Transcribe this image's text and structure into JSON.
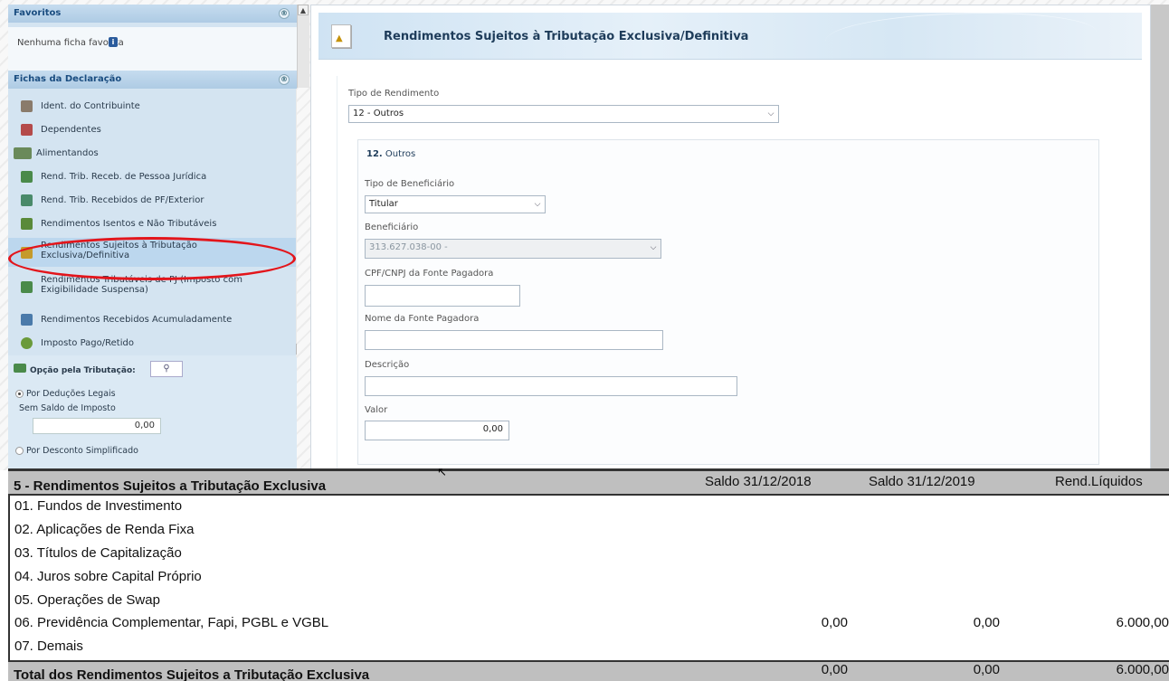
{
  "sidebar": {
    "favoritos": {
      "title": "Favoritos",
      "toggle": "®",
      "empty_text": "Nenhuma ficha favorita",
      "info_icon": "info-icon"
    },
    "fichas": {
      "title": "Fichas da Declaração",
      "toggle": "®",
      "items": [
        {
          "label": "Ident. do Contribuinte",
          "icon": "person-icon",
          "color": "#8a7b6b"
        },
        {
          "label": "Dependentes",
          "icon": "dependents-icon",
          "color": "#b44a4a"
        },
        {
          "label": "Alimentandos",
          "icon": "alimentandos-icon",
          "color": "#6a8a5a"
        },
        {
          "label": "Rend. Trib. Receb. de Pessoa Jurídica",
          "icon": "money-icon",
          "color": "#4a8a4a"
        },
        {
          "label": "Rend. Trib. Recebidos de PF/Exterior",
          "icon": "money-icon",
          "color": "#4a8a6a"
        },
        {
          "label": "Rendimentos Isentos e Não Tributáveis",
          "icon": "document-icon",
          "color": "#5a8a3a"
        },
        {
          "label": "Rendimentos Sujeitos à Tributação Exclusiva/Definitiva",
          "icon": "document-warning-icon",
          "color": "#c59a2a"
        },
        {
          "label": "Rendimentos Tributáveis de PJ (Imposto com Exigibilidade Suspensa)",
          "icon": "money-icon",
          "color": "#4a8a4a"
        },
        {
          "label": "Rendimentos Recebidos Acumuladamente",
          "icon": "document-icon",
          "color": "#4a7aaa"
        },
        {
          "label": "Imposto Pago/Retido",
          "icon": "coin-icon",
          "color": "#6a9a3a"
        }
      ]
    },
    "opcao": {
      "title": "Opção pela Tributação:",
      "option1": "Por Deduções Legais",
      "saldo_label": "Sem Saldo de Imposto",
      "saldo_value": "0,00",
      "option2": "Por Desconto Simplificado"
    }
  },
  "main": {
    "title": "Rendimentos Sujeitos à Tributação Exclusiva/Definitiva",
    "tipo_label": "Tipo de Rendimento",
    "tipo_value": "12 - Outros",
    "section_number": "12.",
    "section_title": "Outros",
    "beneficiario_tipo_label": "Tipo de Beneficiário",
    "beneficiario_tipo_value": "Titular",
    "beneficiario_label": "Beneficiário",
    "beneficiario_value": "313.627.038-00 -",
    "cpf_label": "CPF/CNPJ da Fonte Pagadora",
    "cpf_value": "",
    "nome_label": "Nome da Fonte Pagadora",
    "nome_value": "",
    "descricao_label": "Descrição",
    "descricao_value": "",
    "valor_label": "Valor",
    "valor_value": "0,00"
  },
  "report": {
    "title": "5 - Rendimentos Sujeitos a Tributação Exclusiva",
    "columns": [
      "Saldo 31/12/2018",
      "Saldo 31/12/2019",
      "Rend.Líquidos"
    ],
    "rows": [
      {
        "label": "01. Fundos de Investimento"
      },
      {
        "label": "02. Aplicações de Renda Fixa"
      },
      {
        "label": "03. Títulos de Capitalização"
      },
      {
        "label": "04. Juros sobre Capital Próprio"
      },
      {
        "label": "05. Operações de Swap"
      },
      {
        "label": "06. Previdência Complementar, Fapi, PGBL e VGBL",
        "v1": "0,00",
        "v2": "0,00",
        "v3": "6.000,00"
      },
      {
        "label": "07. Demais"
      }
    ],
    "total": {
      "label": "Total dos Rendimentos Sujeitos a Tributação Exclusiva",
      "v1": "0,00",
      "v2": "0,00",
      "v3": "6.000,00"
    }
  },
  "colors": {
    "highlight_oval": "#e3151b",
    "sidebar_bg": "#d4e4f1",
    "header_blue": "#1e3c5a"
  }
}
